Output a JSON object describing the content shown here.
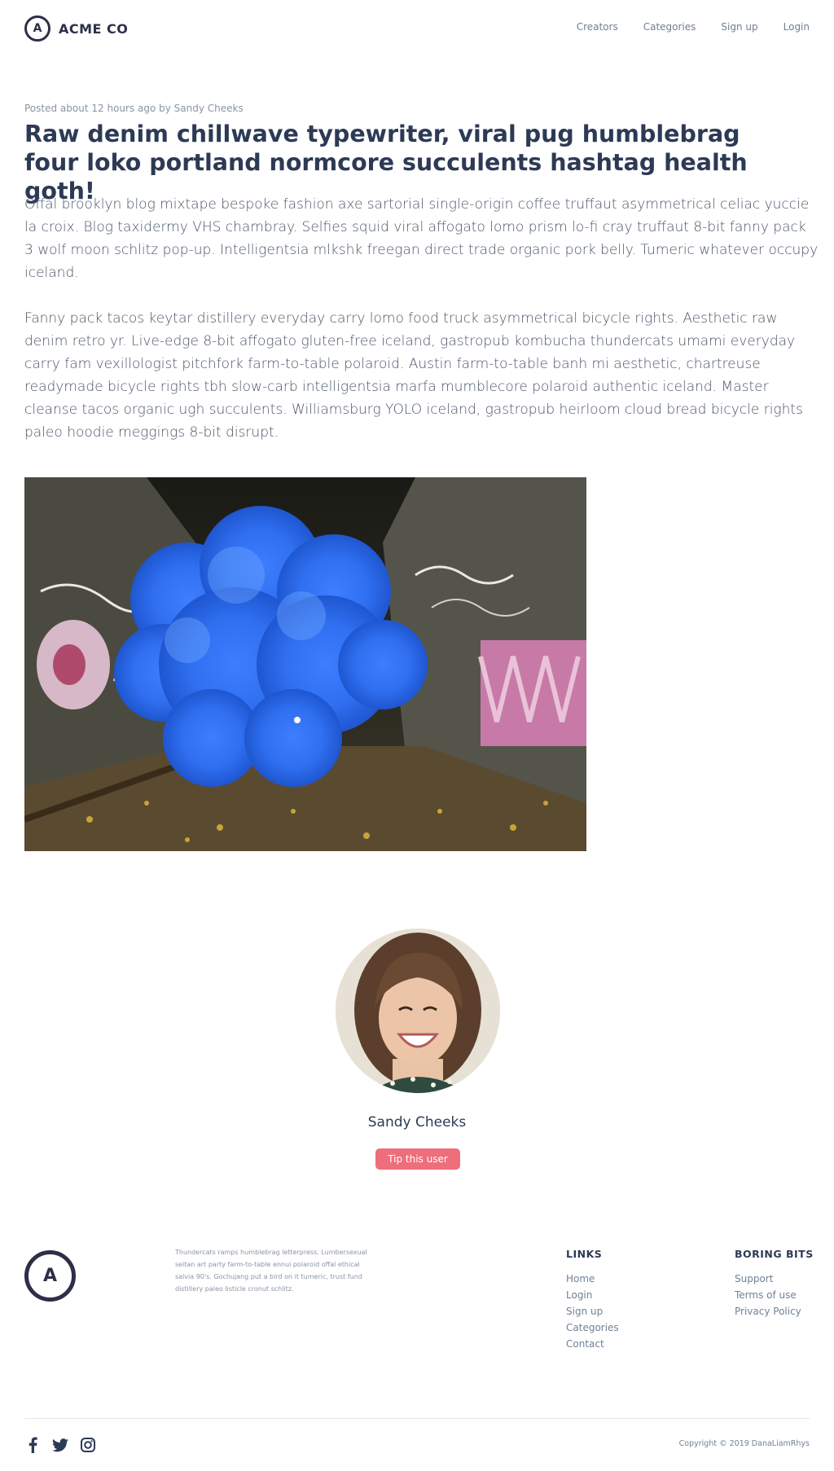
{
  "header": {
    "logo_letter": "A",
    "logo_text": "ACME CO",
    "nav": [
      "Creators",
      "Categories",
      "Sign up",
      "Login"
    ]
  },
  "article": {
    "meta": "Posted about 12 hours ago by Sandy Cheeks",
    "title": "Raw denim chillwave typewriter, viral pug humblebrag four loko portland normcore succulents hashtag health goth!",
    "paragraphs": [
      "Offal brooklyn blog mixtape bespoke fashion axe sartorial single-origin coffee truffaut asymmetrical celiac yuccie la croix. Blog taxidermy VHS chambray. Selfies squid viral affogato lomo prism lo-fi cray truffaut 8-bit fanny pack 3 wolf moon schlitz pop-up. Intelligentsia mlkshk freegan direct trade organic pork belly. Tumeric whatever occupy iceland.",
      "Fanny pack tacos keytar distillery everyday carry lomo food truck asymmetrical bicycle rights. Aesthetic raw denim retro yr. Live-edge 8-bit affogato gluten-free iceland, gastropub kombucha thundercats umami everyday carry fam vexillologist pitchfork farm-to-table polaroid. Austin farm-to-table banh mi aesthetic, chartreuse readymade bicycle rights tbh slow-carb intelligentsia marfa mumblecore polaroid authentic iceland. Master cleanse tacos organic ugh succulents. Williamsburg YOLO iceland, gastropub heirloom cloud bread bicycle rights paleo hoodie meggings 8-bit disrupt."
    ]
  },
  "author": {
    "name": "Sandy Cheeks",
    "tip_label": "Tip this user"
  },
  "footer": {
    "logo_letter": "A",
    "blurb": "Thundercats ramps humblebrag letterpress. Lumbersexual seitan art party farm-to-table ennui polaroid offal ethical salvia 90's. Gochujang put a bird on it tumeric, trust fund distillery paleo listicle cronut schlitz.",
    "links_heading": "LINKS",
    "links": [
      "Home",
      "Login",
      "Sign up",
      "Categories",
      "Contact"
    ],
    "boring_heading": "BORING BITS",
    "boring": [
      "Support",
      "Terms of use",
      "Privacy Policy"
    ],
    "socials": [
      "facebook-icon",
      "twitter-icon",
      "instagram-icon"
    ],
    "copyright": "Copyright © 2019 DanaLiamRhys"
  },
  "colors": {
    "heading": "#2d3a55",
    "body_text": "#4a5568",
    "muted": "#718096",
    "tip_button": "#ee6e7b",
    "logo": "#2d2f48"
  }
}
